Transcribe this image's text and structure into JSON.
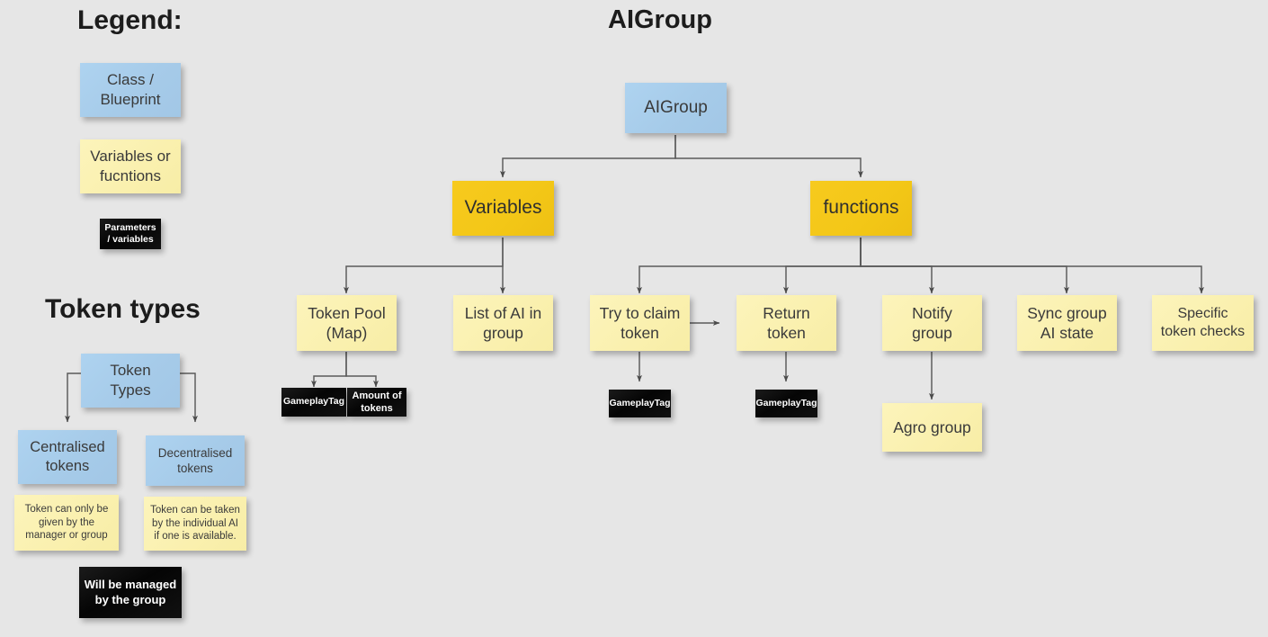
{
  "background_color": "#e6e6e6",
  "palette": {
    "class_blueprint": "#a8cdec",
    "variables_functions_header": "#f5c51f",
    "variables_functions": "#faf1b3",
    "parameters": "#0a0a0a",
    "edge": "#555555",
    "text": "#333333"
  },
  "headings": {
    "legend": "Legend:",
    "aigroup": "AIGroup",
    "token_types": "Token types"
  },
  "legend": {
    "items": [
      {
        "label": "Class /\nBlueprint",
        "style": "blue"
      },
      {
        "label": "Variables or\nfucntions",
        "style": "yellow"
      },
      {
        "label": "Parameters\n/ variables",
        "style": "black"
      }
    ]
  },
  "token_types": {
    "root": {
      "label": "Token\nTypes",
      "style": "blue"
    },
    "children": [
      {
        "label": "Centralised\ntokens",
        "style": "blue",
        "note": "Token can only be\ngiven by the\nmanager or group"
      },
      {
        "label": "Decentralised\ntokens",
        "style": "blue",
        "note": "Token can be taken\nby the individual AI\nif one is available."
      }
    ],
    "footnote": "Will be managed\nby the group"
  },
  "aigroup": {
    "root": {
      "label": "AIGroup",
      "style": "blue"
    },
    "branches": [
      {
        "label": "Variables",
        "style": "gold",
        "children": [
          {
            "label": "Token Pool\n(Map)",
            "style": "yellow",
            "params": [
              "GameplayTag",
              "Amount of\ntokens"
            ]
          },
          {
            "label": "List of AI in\ngroup",
            "style": "yellow",
            "params": []
          }
        ]
      },
      {
        "label": "functions",
        "style": "gold",
        "children": [
          {
            "label": "Try to claim\ntoken",
            "style": "yellow",
            "params": [
              "GameplayTag"
            ]
          },
          {
            "label": "Return\ntoken",
            "style": "yellow",
            "params": [
              "GameplayTag"
            ]
          },
          {
            "label": "Notify\ngroup",
            "style": "yellow",
            "params": [],
            "child": {
              "label": "Agro group",
              "style": "yellow"
            }
          },
          {
            "label": "Sync group\nAI state",
            "style": "yellow",
            "params": []
          },
          {
            "label": "Specific\ntoken checks",
            "style": "yellow",
            "params": []
          }
        ]
      }
    ],
    "flow_arrow": {
      "from": "Try to claim token",
      "to": "Return token"
    }
  }
}
